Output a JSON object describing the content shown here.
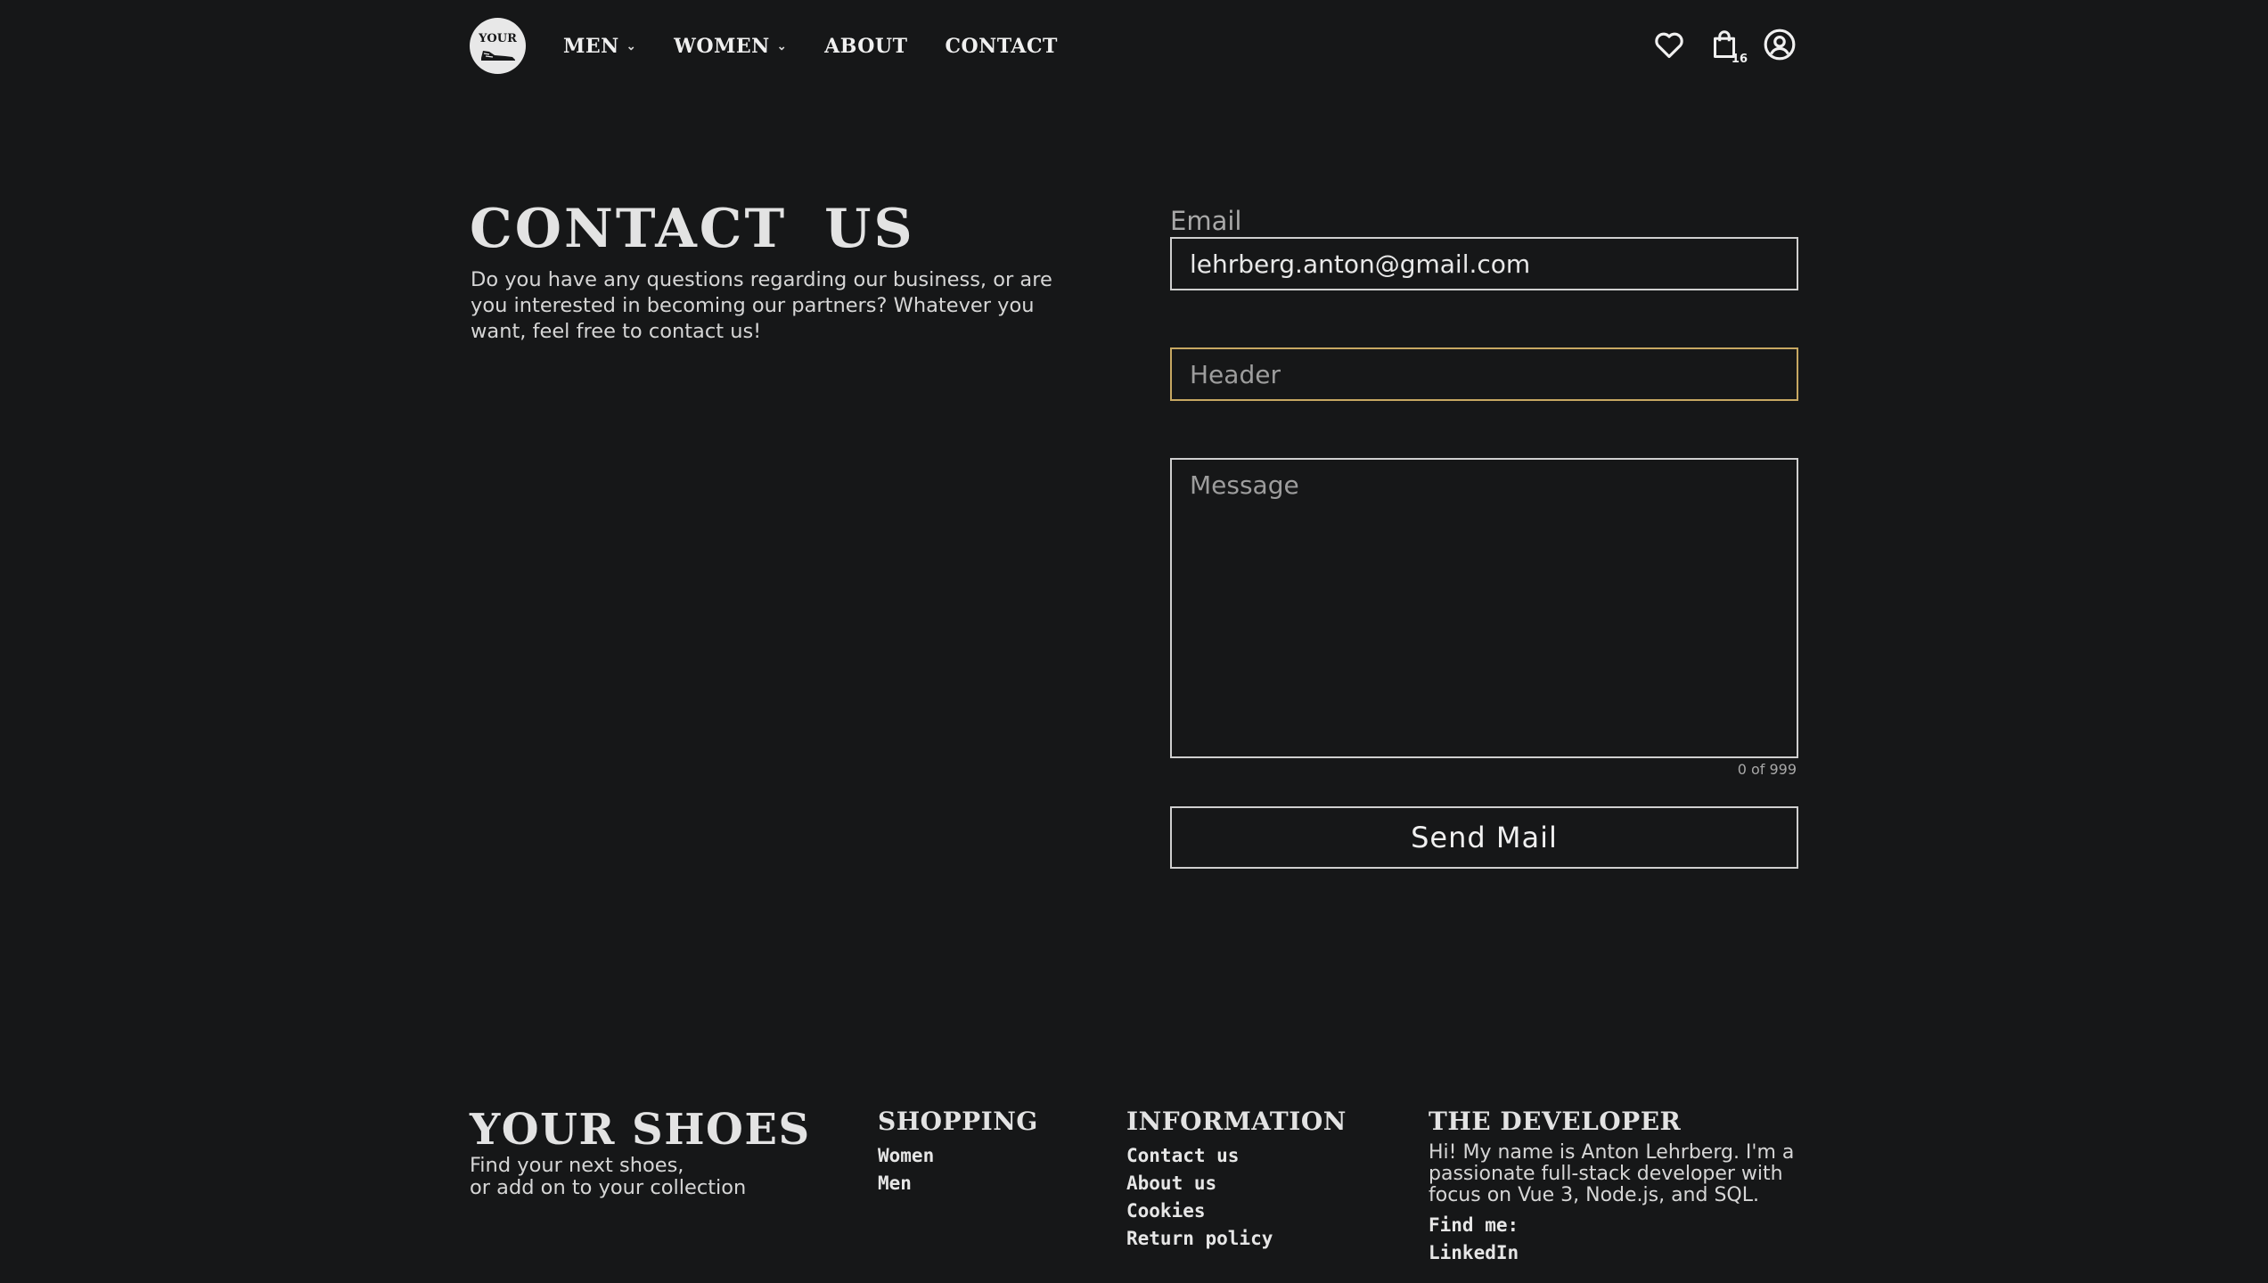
{
  "nav": {
    "logo_text": "YOUR",
    "links": [
      {
        "label": "MEN",
        "chevron": true
      },
      {
        "label": "WOMEN",
        "chevron": true
      },
      {
        "label": "ABOUT",
        "chevron": false
      },
      {
        "label": "CONTACT",
        "chevron": false
      }
    ],
    "icons": [
      "heart-icon",
      "shopping-bag-icon",
      "user-circle-icon"
    ],
    "cart_count": "16"
  },
  "main": {
    "title": "CONTACT US",
    "description": "Do you have any questions regarding our business, or are you interested in becoming our partners? Whatever you want, feel free to contact us!",
    "form": {
      "email_label": "Email",
      "email_value": "lehrberg.anton@gmail.com",
      "header_placeholder": "Header",
      "message_placeholder": "Message",
      "counter": "0 of 999",
      "send_label": "Send Mail"
    }
  },
  "footer": {
    "brand_title": "YOUR SHOES",
    "brand_line1": "Find your next shoes,",
    "brand_line2": "or add on to your collection",
    "shopping": {
      "heading": "SHOPPING",
      "links": [
        "Women",
        "Men"
      ]
    },
    "information": {
      "heading": "INFORMATION",
      "links": [
        "Contact us",
        "About us",
        "Cookies",
        "Return policy"
      ]
    },
    "developer": {
      "heading": "THE DEVELOPER",
      "text": "Hi! My name is Anton Lehrberg. I'm a passionate full-stack developer with focus on Vue 3, Node.js, and SQL.",
      "find_me": "Find me:",
      "links": [
        "LinkedIn"
      ]
    }
  },
  "colors": {
    "background": "#161718",
    "text": "#e6e6e6",
    "focus_border": "#c7a862"
  }
}
